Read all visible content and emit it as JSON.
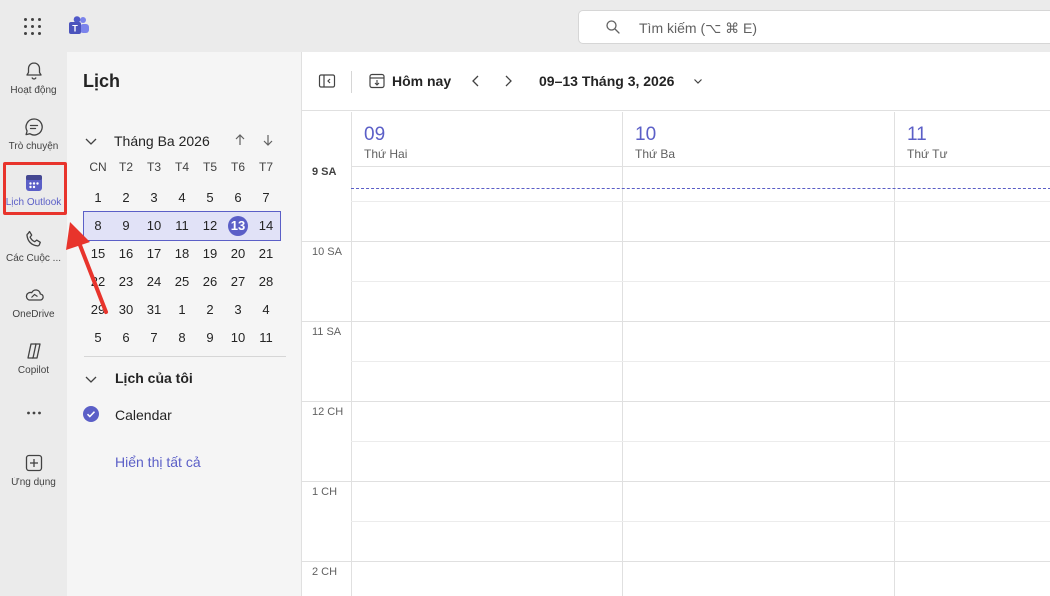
{
  "search": {
    "placeholder": "Tìm kiếm (⌥ ⌘ E)"
  },
  "rail": {
    "items": [
      {
        "label": "Hoạt động",
        "icon": "bell-icon"
      },
      {
        "label": "Trò chuyện",
        "icon": "chat-icon"
      },
      {
        "label": "Lịch Outlook",
        "icon": "calendar-icon",
        "active": true
      },
      {
        "label": "Các Cuộc ...",
        "icon": "phone-icon"
      },
      {
        "label": "OneDrive",
        "icon": "onedrive-icon"
      },
      {
        "label": "Copilot",
        "icon": "copilot-icon"
      },
      {
        "label": "",
        "icon": "more-icon"
      },
      {
        "label": "Ứng dụng",
        "icon": "add-app-icon"
      }
    ]
  },
  "sidepanel": {
    "title": "Lịch",
    "month_label": "Tháng Ba 2026",
    "weekdays": [
      "CN",
      "T2",
      "T3",
      "T4",
      "T5",
      "T6",
      "T7"
    ],
    "weeks": [
      [
        "1",
        "2",
        "3",
        "4",
        "5",
        "6",
        "7"
      ],
      [
        "8",
        "9",
        "10",
        "11",
        "12",
        "13",
        "14"
      ],
      [
        "15",
        "16",
        "17",
        "18",
        "19",
        "20",
        "21"
      ],
      [
        "22",
        "23",
        "24",
        "25",
        "26",
        "27",
        "28"
      ],
      [
        "29",
        "30",
        "31",
        "1",
        "2",
        "3",
        "4"
      ],
      [
        "5",
        "6",
        "7",
        "8",
        "9",
        "10",
        "11"
      ]
    ],
    "selected_week_index": 1,
    "today": "13",
    "my_calendars_label": "Lịch của tôi",
    "calendar_name": "Calendar",
    "show_all_label": "Hiển thị tất cả"
  },
  "toolbar": {
    "today_label": "Hôm nay",
    "range_label": "09–13 Tháng 3, 2026"
  },
  "days": [
    {
      "num": "09",
      "name": "Thứ Hai"
    },
    {
      "num": "10",
      "name": "Thứ Ba"
    },
    {
      "num": "11",
      "name": "Thứ Tư"
    }
  ],
  "hours": [
    "9 SA",
    "10 SA",
    "11 SA",
    "12 CH",
    "1 CH",
    "2 CH"
  ],
  "colors": {
    "accent": "#5b5fc7",
    "annotation": "#e8342c"
  }
}
